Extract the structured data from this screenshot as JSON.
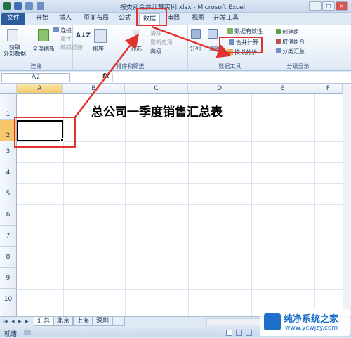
{
  "window": {
    "title": "按类别合并计算实例.xlsx - Microsoft Excel"
  },
  "tabs": [
    {
      "label": "文件",
      "active": false
    },
    {
      "label": "开始",
      "active": false
    },
    {
      "label": "插入",
      "active": false
    },
    {
      "label": "页面布局",
      "active": false
    },
    {
      "label": "公式",
      "active": false
    },
    {
      "label": "数据",
      "active": true
    },
    {
      "label": "审阅",
      "active": false
    },
    {
      "label": "视图",
      "active": false
    },
    {
      "label": "开发工具",
      "active": false
    }
  ],
  "ribbon": {
    "get_external": "获取\n外部数据",
    "refresh_all": "全部刷新",
    "connections": "连接",
    "properties": "属性",
    "edit_links": "编辑链接",
    "group_connections": "连接",
    "sort": "排序",
    "filter": "筛选",
    "clear": "清除",
    "reapply": "重新应用",
    "advanced": "高级",
    "group_sort": "排序和筛选",
    "text_to_columns": "分列",
    "remove_dup": "删除",
    "data_validation": "数据有效性",
    "consolidate": "合并计算",
    "what_if": "模拟分析",
    "group_data_tools": "数据工具",
    "group_btn": "创建组",
    "ungroup_btn": "取消组合",
    "subtotal": "分类汇总",
    "group_outline": "分级显示"
  },
  "formula_bar": {
    "name_box": "A2",
    "fx": "fx",
    "value": ""
  },
  "grid": {
    "columns": [
      "A",
      "B",
      "C",
      "D",
      "E",
      "F"
    ],
    "rows": [
      "1",
      "2",
      "3",
      "4",
      "5",
      "6",
      "7",
      "8",
      "9",
      "10"
    ],
    "title": "总公司一季度销售汇总表"
  },
  "sheets": [
    "汇总",
    "北京",
    "上海",
    "深圳"
  ],
  "active_sheet": "汇总",
  "status": {
    "text": "就绪"
  },
  "watermark": {
    "title": "纯净系统之家",
    "url": "www.ycwjzy.com"
  },
  "colors": {
    "accent": "#2c5b9c",
    "annotation": "#e0322e",
    "selected_header": "#f5c66b"
  }
}
